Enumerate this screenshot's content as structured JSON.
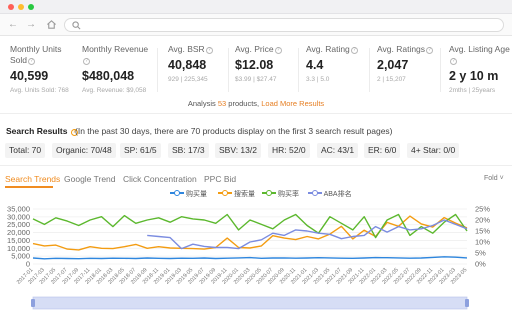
{
  "stats": [
    {
      "label": "Monthly Units Sold",
      "value": "40,599",
      "sub": "Avg. Units Sold: 768",
      "info_style": "grey"
    },
    {
      "label": "Monthly Revenue",
      "value": "$480,048",
      "sub": "Avg. Revenue: $9,058",
      "info_style": "grey"
    },
    {
      "label": "Avg. BSR",
      "value": "40,848",
      "sub": "929  |  225,345",
      "info_style": "grey"
    },
    {
      "label": "Avg. Price",
      "value": "$12.08",
      "sub": "$3.99  |  $27.47",
      "info_style": "grey"
    },
    {
      "label": "Avg. Rating",
      "value": "4.4",
      "sub": "3.3  |  5.0",
      "info_style": "grey"
    },
    {
      "label": "Avg. Ratings",
      "value": "2,047",
      "sub": "2  |  15,207",
      "info_style": "grey"
    },
    {
      "label": "Avg. Listing Age",
      "value": "2 y 10 m",
      "sub": "2mths  |  25years",
      "info_style": "grey"
    }
  ],
  "analysis": {
    "prefix": "Analysis",
    "count": "53",
    "suffix": "products,",
    "link": "Load More Results"
  },
  "search_results": {
    "title": "Search Results",
    "description": "(In the past 30 days, there are 70 products display on the first 3 search result pages)",
    "chips": [
      "Total: 70",
      "Organic: 70/48",
      "SP: 61/5",
      "SB: 17/3",
      "SBV: 13/2",
      "HR: 52/0",
      "AC: 43/1",
      "ER: 6/0",
      "4+ Star: 0/0"
    ]
  },
  "tabs": [
    "Search Trends",
    "Google Trend",
    "Click Concentration",
    "PPC Bid"
  ],
  "fold_label": "Fold",
  "icons": {
    "back": "arrow-left-icon",
    "forward": "arrow-right-icon",
    "home": "home-icon",
    "search": "search-icon",
    "info": "info-icon",
    "fold": "chevron-down-icon"
  },
  "colors": {
    "accent": "#f08c21",
    "series_purchase": "#2e86de",
    "series_search": "#f39c12",
    "series_rate": "#5cb82e",
    "series_aba": "#7b8ce0"
  },
  "chart_data": {
    "type": "line",
    "series": [
      {
        "name": "购买量",
        "axis": "left",
        "color": "#2e86de"
      },
      {
        "name": "搜索量",
        "axis": "left",
        "color": "#f39c12"
      },
      {
        "name": "购买率",
        "axis": "right",
        "color": "#5cb82e"
      },
      {
        "name": "ABA排名",
        "axis": "right",
        "color": "#7b8ce0"
      }
    ],
    "y_left": {
      "ticks": [
        "0",
        "5,000",
        "10,000",
        "15,000",
        "20,000",
        "25,000",
        "30,000",
        "35,000"
      ],
      "range": [
        0,
        35000
      ]
    },
    "y_right": {
      "ticks": [
        "0%",
        "5%",
        "10%",
        "15%",
        "20%",
        "25%"
      ],
      "range": [
        0,
        25
      ]
    },
    "x_labels": [
      "2017-01",
      "2017-03",
      "2017-05",
      "2017-07",
      "2017-09",
      "2017-11",
      "2018-01",
      "2018-03",
      "2018-05",
      "2018-07",
      "2018-09",
      "2018-11",
      "2019-01",
      "2019-03",
      "2019-05",
      "2019-07",
      "2019-09",
      "2019-11",
      "2020-01",
      "2020-03",
      "2020-05",
      "2020-07",
      "2020-09",
      "2020-11",
      "2021-01",
      "2021-03",
      "2021-05",
      "2021-07",
      "2021-09",
      "2021-11",
      "2022-01",
      "2022-03",
      "2022-05",
      "2022-07",
      "2022-09",
      "2022-11",
      "2023-01",
      "2023-03",
      "2023-05"
    ],
    "values": {
      "购买量": [
        3800,
        3300,
        3600,
        3500,
        3400,
        3600,
        3500,
        3700,
        3600,
        3500,
        3800,
        3600,
        3500,
        3700,
        3600,
        3800,
        3500,
        3700,
        3900,
        4100,
        3600,
        3800,
        3900,
        3700,
        3800,
        4000,
        3900,
        3700,
        3600,
        3800,
        4100,
        4000,
        3900,
        3700,
        3800,
        4200,
        4600,
        4300,
        3900
      ],
      "搜索量": [
        13000,
        11500,
        12000,
        9500,
        9000,
        11000,
        10000,
        9800,
        11000,
        12500,
        10000,
        11000,
        10200,
        10000,
        9800,
        9500,
        10500,
        16500,
        10500,
        10200,
        11500,
        18000,
        16500,
        15500,
        17500,
        16000,
        19000,
        24000,
        16000,
        21500,
        17500,
        26500,
        24000,
        30500,
        25500,
        23500,
        29500,
        26000,
        23000
      ],
      "购买率": [
        20.5,
        18,
        21,
        19.5,
        17.5,
        20,
        21.5,
        17,
        22,
        18.5,
        20,
        21,
        19,
        21.5,
        20.5,
        20,
        18.5,
        22.5,
        15.5,
        20,
        18,
        16,
        20,
        22.5,
        17.5,
        14,
        21.5,
        18.5,
        15.5,
        21.5,
        12,
        20,
        22.5,
        13,
        17,
        14,
        19,
        22.5,
        15
      ],
      "ABA排名": [
        null,
        null,
        null,
        null,
        null,
        null,
        null,
        null,
        null,
        null,
        13,
        12.5,
        12,
        7,
        9,
        8,
        7.5,
        7.5,
        7,
        10,
        11,
        14,
        13,
        15.5,
        15,
        14,
        13.5,
        11.5,
        12.5,
        13,
        17,
        14.5,
        17,
        15.5,
        16,
        17.5,
        20,
        18,
        16
      ]
    }
  }
}
